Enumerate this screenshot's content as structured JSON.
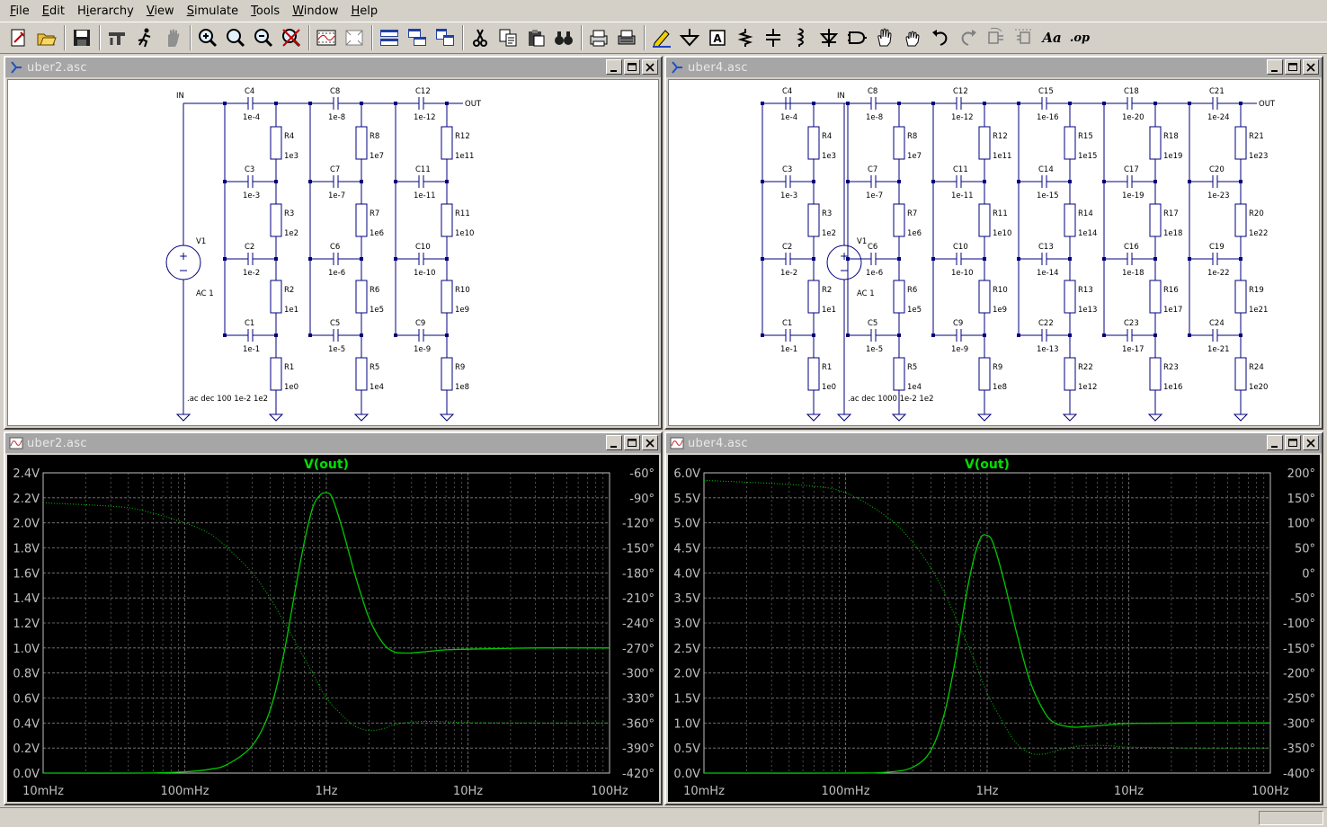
{
  "menu": [
    {
      "label": "File",
      "u": "F",
      "rest": "ile"
    },
    {
      "label": "Edit",
      "u": "E",
      "rest": "dit"
    },
    {
      "label": "Hierarchy",
      "pre": "H",
      "u": "i",
      "rest": "erarchy"
    },
    {
      "label": "View",
      "u": "V",
      "rest": "iew"
    },
    {
      "label": "Simulate",
      "u": "S",
      "rest": "imulate"
    },
    {
      "label": "Tools",
      "u": "T",
      "rest": "ools"
    },
    {
      "label": "Window",
      "u": "W",
      "rest": "indow"
    },
    {
      "label": "Help",
      "u": "H",
      "rest": "elp"
    }
  ],
  "toolbar_groups": [
    [
      "new-schematic-icon",
      "open-folder-icon"
    ],
    [
      "save-icon"
    ],
    [
      "control-panel-icon",
      "run-icon",
      "halt-icon"
    ],
    [
      "zoom-in-icon",
      "zoom-pan-icon",
      "zoom-out-icon",
      "zoom-cancel-icon"
    ],
    [
      "plot-icon",
      "autorange-icon"
    ],
    [
      "tile-horizontal-icon",
      "cascade-icon",
      "tile-vertical-icon"
    ],
    [
      "cut-icon",
      "copy-icon",
      "paste-icon",
      "find-icon"
    ],
    [
      "print-icon",
      "print-setup-icon"
    ],
    [
      "pencil-wire-icon",
      "ground-icon",
      "label-net-icon",
      "resistor-icon",
      "capacitor-icon",
      "inductor-icon",
      "diode-icon",
      "component-icon",
      "move-hand-icon",
      "drag-hand-icon",
      "undo-icon",
      "redo-icon",
      "rotate-icon",
      "mirror-icon",
      "text-icon",
      "spice-directive-icon"
    ]
  ],
  "toolbar_text": {
    "text_icon": "Aa",
    "op_icon": ".op"
  },
  "schematics": [
    {
      "title": "uber2.asc",
      "in_label": "IN",
      "out_label": "OUT",
      "source": {
        "name": "V1",
        "value": "AC 1"
      },
      "directive": ".ac dec 100 1e-2 1e2",
      "columns": [
        {
          "caps": [
            {
              "name": "C4",
              "value": "1e-4"
            },
            {
              "name": "C3",
              "value": "1e-3"
            },
            {
              "name": "C2",
              "value": "1e-2"
            },
            {
              "name": "C1",
              "value": "1e-1"
            }
          ],
          "res": [
            {
              "name": "R4",
              "value": "1e3"
            },
            {
              "name": "R3",
              "value": "1e2"
            },
            {
              "name": "R2",
              "value": "1e1"
            },
            {
              "name": "R1",
              "value": "1e0"
            }
          ]
        },
        {
          "caps": [
            {
              "name": "C8",
              "value": "1e-8"
            },
            {
              "name": "C7",
              "value": "1e-7"
            },
            {
              "name": "C6",
              "value": "1e-6"
            },
            {
              "name": "C5",
              "value": "1e-5"
            }
          ],
          "res": [
            {
              "name": "R8",
              "value": "1e7"
            },
            {
              "name": "R7",
              "value": "1e6"
            },
            {
              "name": "R6",
              "value": "1e5"
            },
            {
              "name": "R5",
              "value": "1e4"
            }
          ]
        },
        {
          "caps": [
            {
              "name": "C12",
              "value": "1e-12"
            },
            {
              "name": "C11",
              "value": "1e-11"
            },
            {
              "name": "C10",
              "value": "1e-10"
            },
            {
              "name": "C9",
              "value": "1e-9"
            }
          ],
          "res": [
            {
              "name": "R12",
              "value": "1e11"
            },
            {
              "name": "R11",
              "value": "1e10"
            },
            {
              "name": "R10",
              "value": "1e9"
            },
            {
              "name": "R9",
              "value": "1e8"
            }
          ]
        }
      ]
    },
    {
      "title": "uber4.asc",
      "in_label": "IN",
      "out_label": "OUT",
      "source": {
        "name": "V1",
        "value": "AC 1"
      },
      "directive": ".ac dec 1000 1e-2 1e2",
      "columns": [
        {
          "caps": [
            {
              "name": "C4",
              "value": "1e-4"
            },
            {
              "name": "C3",
              "value": "1e-3"
            },
            {
              "name": "C2",
              "value": "1e-2"
            },
            {
              "name": "C1",
              "value": "1e-1"
            }
          ],
          "res": [
            {
              "name": "R4",
              "value": "1e3"
            },
            {
              "name": "R3",
              "value": "1e2"
            },
            {
              "name": "R2",
              "value": "1e1"
            },
            {
              "name": "R1",
              "value": "1e0"
            }
          ]
        },
        {
          "caps": [
            {
              "name": "C8",
              "value": "1e-8"
            },
            {
              "name": "C7",
              "value": "1e-7"
            },
            {
              "name": "C6",
              "value": "1e-6"
            },
            {
              "name": "C5",
              "value": "1e-5"
            }
          ],
          "res": [
            {
              "name": "R8",
              "value": "1e7"
            },
            {
              "name": "R7",
              "value": "1e6"
            },
            {
              "name": "R6",
              "value": "1e5"
            },
            {
              "name": "R5",
              "value": "1e4"
            }
          ]
        },
        {
          "caps": [
            {
              "name": "C12",
              "value": "1e-12"
            },
            {
              "name": "C11",
              "value": "1e-11"
            },
            {
              "name": "C10",
              "value": "1e-10"
            },
            {
              "name": "C9",
              "value": "1e-9"
            }
          ],
          "res": [
            {
              "name": "R12",
              "value": "1e11"
            },
            {
              "name": "R11",
              "value": "1e10"
            },
            {
              "name": "R10",
              "value": "1e9"
            },
            {
              "name": "R9",
              "value": "1e8"
            }
          ]
        },
        {
          "caps": [
            {
              "name": "C15",
              "value": "1e-16"
            },
            {
              "name": "C14",
              "value": "1e-15"
            },
            {
              "name": "C13",
              "value": "1e-14"
            },
            {
              "name": "C22",
              "value": "1e-13"
            }
          ],
          "res": [
            {
              "name": "R15",
              "value": "1e15"
            },
            {
              "name": "R14",
              "value": "1e14"
            },
            {
              "name": "R13",
              "value": "1e13"
            },
            {
              "name": "R22",
              "value": "1e12"
            }
          ]
        },
        {
          "caps": [
            {
              "name": "C18",
              "value": "1e-20"
            },
            {
              "name": "C17",
              "value": "1e-19"
            },
            {
              "name": "C16",
              "value": "1e-18"
            },
            {
              "name": "C23",
              "value": "1e-17"
            }
          ],
          "res": [
            {
              "name": "R18",
              "value": "1e19"
            },
            {
              "name": "R17",
              "value": "1e18"
            },
            {
              "name": "R16",
              "value": "1e17"
            },
            {
              "name": "R23",
              "value": "1e16"
            }
          ]
        },
        {
          "caps": [
            {
              "name": "C21",
              "value": "1e-24"
            },
            {
              "name": "C20",
              "value": "1e-23"
            },
            {
              "name": "C19",
              "value": "1e-22"
            },
            {
              "name": "C24",
              "value": "1e-21"
            }
          ],
          "res": [
            {
              "name": "R21",
              "value": "1e23"
            },
            {
              "name": "R20",
              "value": "1e22"
            },
            {
              "name": "R19",
              "value": "1e21"
            },
            {
              "name": "R24",
              "value": "1e20"
            }
          ]
        }
      ]
    }
  ],
  "chart_data": [
    {
      "type": "line",
      "window_title": "uber2.asc",
      "title": "V(out)",
      "x_scale": "log",
      "xlim": [
        0.01,
        100
      ],
      "x_ticks": [
        "10mHz",
        "100mHz",
        "1Hz",
        "10Hz",
        "100Hz"
      ],
      "ylim": [
        0.0,
        2.4
      ],
      "y_ticks": [
        "0.0V",
        "0.2V",
        "0.4V",
        "0.6V",
        "0.8V",
        "1.0V",
        "1.2V",
        "1.4V",
        "1.6V",
        "1.8V",
        "2.0V",
        "2.2V",
        "2.4V"
      ],
      "y2lim": [
        -420,
        -60
      ],
      "y2_ticks": [
        "-420°",
        "-390°",
        "-360°",
        "-330°",
        "-300°",
        "-270°",
        "-240°",
        "-210°",
        "-180°",
        "-150°",
        "-120°",
        "-90°",
        "-60°"
      ],
      "grid": true,
      "line_color": "#00c800",
      "series": [
        {
          "kind": "magnitude",
          "style": "solid",
          "x": [
            0.01,
            0.05,
            0.1,
            0.15,
            0.2,
            0.3,
            0.4,
            0.5,
            0.6,
            0.7,
            0.8,
            0.9,
            1.0,
            1.1,
            1.3,
            1.6,
            2.0,
            2.5,
            3.0,
            3.5,
            4.0,
            5.0,
            7.0,
            10,
            30,
            100
          ],
          "y": [
            0.0,
            0.0,
            0.01,
            0.03,
            0.07,
            0.22,
            0.5,
            0.95,
            1.45,
            1.85,
            2.12,
            2.22,
            2.24,
            2.2,
            1.95,
            1.58,
            1.24,
            1.04,
            0.97,
            0.96,
            0.96,
            0.97,
            0.985,
            0.99,
            1.0,
            1.0
          ]
        },
        {
          "kind": "phase",
          "style": "dotted",
          "x": [
            0.01,
            0.03,
            0.05,
            0.1,
            0.15,
            0.2,
            0.3,
            0.4,
            0.5,
            0.6,
            0.8,
            1.0,
            1.3,
            1.6,
            2.0,
            2.5,
            3.0,
            4.0,
            5.0,
            7.0,
            10,
            30,
            100
          ],
          "y": [
            -96,
            -100,
            -105,
            -120,
            -133,
            -150,
            -180,
            -210,
            -238,
            -262,
            -300,
            -330,
            -351,
            -364,
            -369,
            -367,
            -362,
            -359,
            -358,
            -358.5,
            -359.5,
            -360,
            -360
          ]
        }
      ]
    },
    {
      "type": "line",
      "window_title": "uber4.asc",
      "title": "V(out)",
      "x_scale": "log",
      "xlim": [
        0.01,
        100
      ],
      "x_ticks": [
        "10mHz",
        "100mHz",
        "1Hz",
        "10Hz",
        "100Hz"
      ],
      "ylim": [
        0.0,
        6.0
      ],
      "y_ticks": [
        "0.0V",
        "0.5V",
        "1.0V",
        "1.5V",
        "2.0V",
        "2.5V",
        "3.0V",
        "3.5V",
        "4.0V",
        "4.5V",
        "5.0V",
        "5.5V",
        "6.0V"
      ],
      "y2lim": [
        -400,
        200
      ],
      "y2_ticks": [
        "-400°",
        "-350°",
        "-300°",
        "-250°",
        "-200°",
        "-150°",
        "-100°",
        "-50°",
        "0°",
        "50°",
        "100°",
        "150°",
        "200°"
      ],
      "grid": true,
      "line_color": "#00c800",
      "series": [
        {
          "kind": "magnitude",
          "style": "solid",
          "x": [
            0.01,
            0.1,
            0.2,
            0.3,
            0.4,
            0.5,
            0.6,
            0.7,
            0.8,
            0.9,
            1.0,
            1.1,
            1.3,
            1.6,
            2.0,
            2.5,
            3.0,
            4.0,
            5.0,
            7.0,
            10,
            30,
            100
          ],
          "y": [
            0.0,
            0.0,
            0.02,
            0.12,
            0.45,
            1.2,
            2.3,
            3.45,
            4.25,
            4.7,
            4.75,
            4.6,
            3.9,
            2.85,
            1.85,
            1.25,
            1.0,
            0.92,
            0.93,
            0.96,
            0.99,
            1.0,
            1.0
          ]
        },
        {
          "kind": "phase",
          "style": "dotted",
          "x": [
            0.01,
            0.05,
            0.1,
            0.2,
            0.3,
            0.4,
            0.5,
            0.6,
            0.8,
            1.0,
            1.3,
            1.6,
            2.0,
            2.5,
            3.0,
            4.0,
            5.0,
            7.0,
            10,
            30,
            100
          ],
          "y": [
            185,
            175,
            160,
            110,
            60,
            10,
            -40,
            -90,
            -170,
            -240,
            -300,
            -340,
            -360,
            -362,
            -356,
            -348,
            -345,
            -345,
            -348,
            -350,
            -350
          ]
        }
      ]
    }
  ]
}
